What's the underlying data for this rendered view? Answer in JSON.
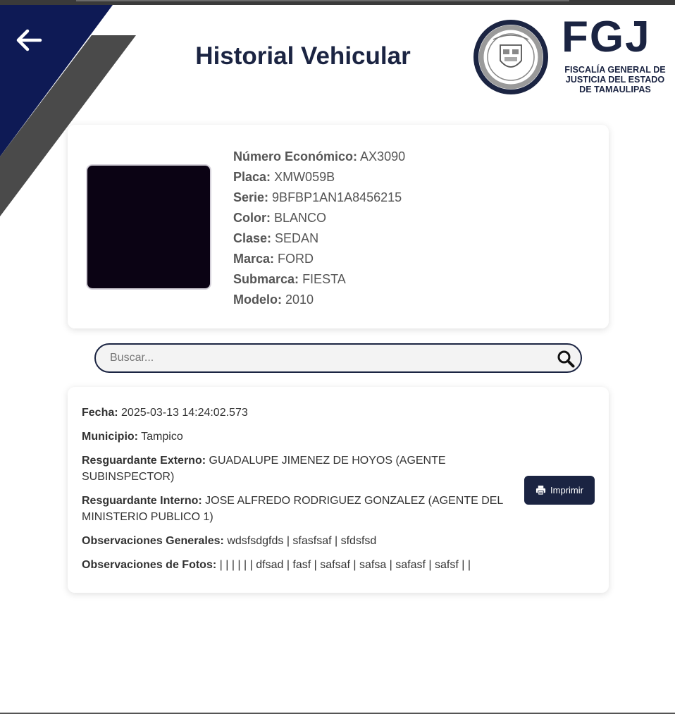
{
  "header": {
    "title": "Historial Vehicular",
    "logo_text": "FGJ",
    "logo_subtitle": "FISCALÍA GENERAL DE JUSTICIA DEL ESTADO DE TAMAULIPAS",
    "back_icon": "arrow-left-icon"
  },
  "colors": {
    "navy": "#1b2442",
    "corner_blue": "#0e1a55",
    "corner_gray": "#4a4a4a",
    "photo_bg": "#0b0314"
  },
  "vehicle": {
    "fields": [
      {
        "label": "Número Económico:",
        "value": "AX3090"
      },
      {
        "label": "Placa:",
        "value": "XMW059B"
      },
      {
        "label": "Serie:",
        "value": "9BFBP1AN1A8456215"
      },
      {
        "label": "Color:",
        "value": "BLANCO"
      },
      {
        "label": "Clase:",
        "value": "SEDAN"
      },
      {
        "label": "Marca:",
        "value": "FORD"
      },
      {
        "label": "Submarca:",
        "value": "FIESTA"
      },
      {
        "label": "Modelo:",
        "value": "2010"
      }
    ]
  },
  "search": {
    "placeholder": "Buscar...",
    "value": "",
    "icon": "search-icon"
  },
  "history": [
    {
      "fields": [
        {
          "label": "Fecha:",
          "value": "2025-03-13 14:24:02.573"
        },
        {
          "label": "Municipio:",
          "value": "Tampico"
        },
        {
          "label": "Resguardante Externo:",
          "value": "GUADALUPE JIMENEZ DE HOYOS (AGENTE SUBINSPECTOR)"
        },
        {
          "label": "Resguardante Interno:",
          "value": "JOSE ALFREDO RODRIGUEZ GONZALEZ (AGENTE DEL MINISTERIO PUBLICO 1)"
        },
        {
          "label": "Observaciones Generales:",
          "value": "wdsfsdgfds | sfasfsaf | sfdsfsd"
        },
        {
          "label": "Observaciones de Fotos:",
          "value": "| | | | | | dfsad | fasf | safsaf | safsa | safasf | safsf | |"
        }
      ],
      "print_label": "Imprimir",
      "print_icon": "printer-icon"
    }
  ]
}
